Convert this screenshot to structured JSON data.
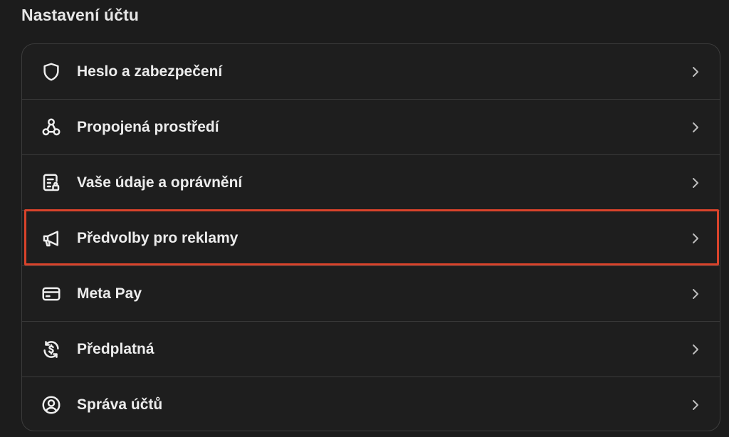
{
  "page": {
    "section_title": "Nastavení účtu"
  },
  "settings_list": {
    "items": [
      {
        "label": "Heslo a zabezpečení",
        "icon": "shield-icon"
      },
      {
        "label": "Propojená prostředí",
        "icon": "connected-nodes-icon"
      },
      {
        "label": "Vaše údaje a oprávnění",
        "icon": "data-permissions-icon"
      },
      {
        "label": "Předvolby pro reklamy",
        "icon": "megaphone-icon",
        "highlighted": true
      },
      {
        "label": "Meta Pay",
        "icon": "card-icon"
      },
      {
        "label": "Předplatná",
        "icon": "subscription-dollar-icon"
      },
      {
        "label": "Správa účtů",
        "icon": "account-circle-icon"
      }
    ],
    "chevron_icon": "chevron-right-icon"
  },
  "colors": {
    "background": "#1c1c1c",
    "panel_border": "#3c3c3c",
    "highlight": "#d9432b",
    "text": "#ececec"
  }
}
